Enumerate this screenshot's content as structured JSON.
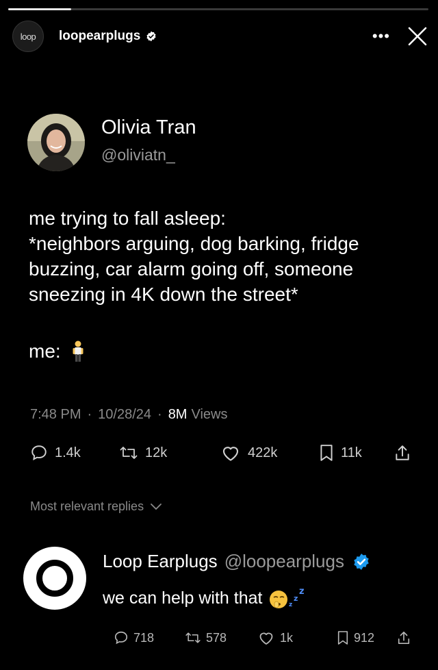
{
  "story": {
    "progress_fraction": 0.15,
    "avatar_label": "loop",
    "username": "loopearplugs",
    "more_label": "•••"
  },
  "tweet": {
    "author_name": "Olivia Tran",
    "author_handle": "@oliviatn_",
    "body_lines": [
      "me trying to fall asleep:",
      "*neighbors arguing, dog barking, fridge buzzing, car alarm going off, someone sneezing in 4K down the street*"
    ],
    "me_label": "me:",
    "time": "7:48 PM",
    "date": "10/28/24",
    "views_count": "8M",
    "views_label": "Views",
    "stats": {
      "replies": "1.4k",
      "retweets": "12k",
      "likes": "422k",
      "bookmarks": "11k"
    }
  },
  "replies_header": "Most relevant replies",
  "reply": {
    "name": "Loop Earplugs",
    "handle": "@loopearplugs",
    "text": "we can help with that",
    "stats": {
      "replies": "718",
      "retweets": "578",
      "likes": "1k",
      "bookmarks": "912"
    }
  },
  "colors": {
    "background": "#000000",
    "verified_blue": "#1d9bf0",
    "muted_text": "#8a8a8a"
  }
}
